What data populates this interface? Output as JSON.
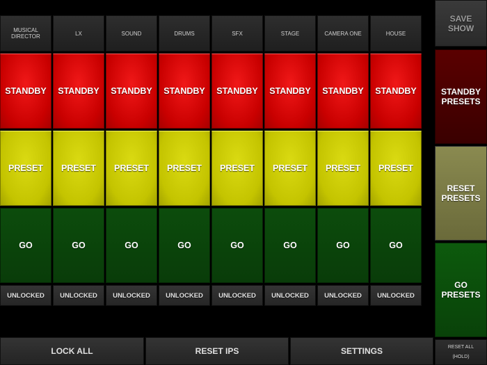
{
  "columns": [
    {
      "name": "MUSICAL DIRECTOR",
      "standby": "STANDBY",
      "preset": "PRESET",
      "go": "GO",
      "lock": "UNLOCKED"
    },
    {
      "name": "LX",
      "standby": "STANDBY",
      "preset": "PRESET",
      "go": "GO",
      "lock": "UNLOCKED"
    },
    {
      "name": "SOUND",
      "standby": "STANDBY",
      "preset": "PRESET",
      "go": "GO",
      "lock": "UNLOCKED"
    },
    {
      "name": "DRUMS",
      "standby": "STANDBY",
      "preset": "PRESET",
      "go": "GO",
      "lock": "UNLOCKED"
    },
    {
      "name": "SFX",
      "standby": "STANDBY",
      "preset": "PRESET",
      "go": "GO",
      "lock": "UNLOCKED"
    },
    {
      "name": "STAGE",
      "standby": "STANDBY",
      "preset": "PRESET",
      "go": "GO",
      "lock": "UNLOCKED"
    },
    {
      "name": "CAMERA ONE",
      "standby": "STANDBY",
      "preset": "PRESET",
      "go": "GO",
      "lock": "UNLOCKED"
    },
    {
      "name": "HOUSE",
      "standby": "STANDBY",
      "preset": "PRESET",
      "go": "GO",
      "lock": "UNLOCKED"
    }
  ],
  "sidebar": {
    "save_show": "SAVE\nSHOW",
    "standby_presets": "STANDBY\nPRESETS",
    "reset_presets": "RESET\nPRESETS",
    "go_presets": "GO\nPRESETS",
    "reset_all": "RESET ALL (HOLD)"
  },
  "bottom": {
    "lock_all": "LOCK ALL",
    "reset_ips": "RESET IPS",
    "settings": "SETTINGS"
  },
  "colors": {
    "standby": "#d60000",
    "preset": "#c8c800",
    "go": "#0a440a",
    "save_text": "#9a9a9a"
  }
}
